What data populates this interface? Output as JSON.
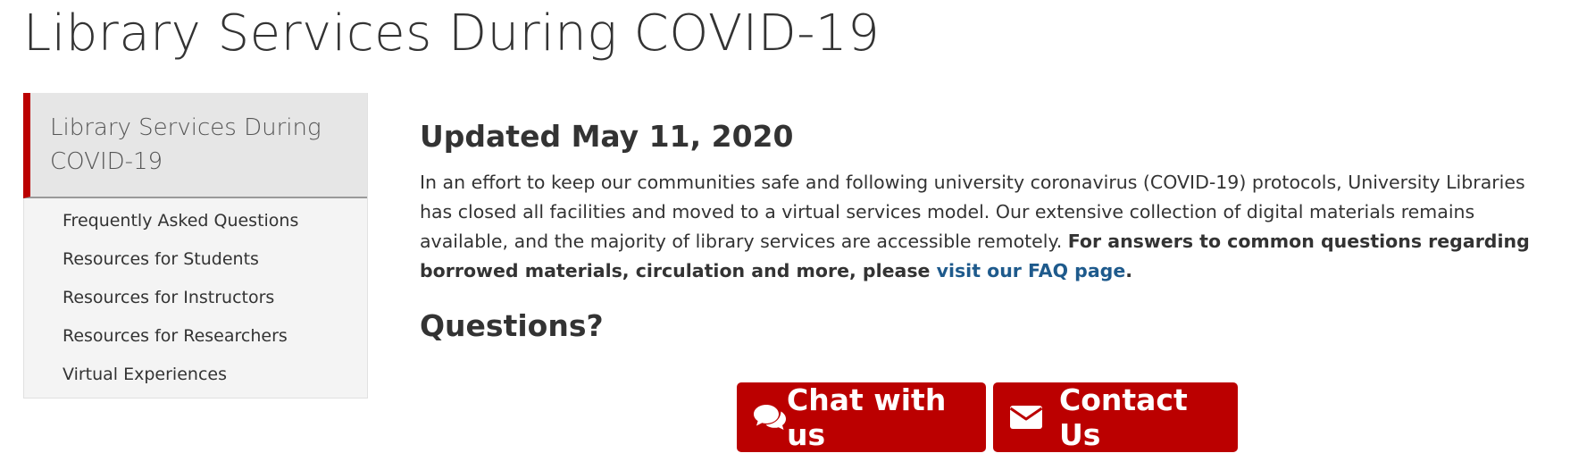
{
  "page": {
    "title": "Library Services During COVID-19"
  },
  "sidebar": {
    "header_label": "Library Services During COVID-19",
    "items": [
      {
        "label": "Frequently Asked Questions"
      },
      {
        "label": "Resources for Students"
      },
      {
        "label": "Resources for Instructors"
      },
      {
        "label": "Resources for Researchers"
      },
      {
        "label": "Virtual Experiences"
      }
    ]
  },
  "main": {
    "updated_heading": "Updated May 11, 2020",
    "intro_text": "In an effort to keep our communities safe and following university coronavirus (COVID-19) protocols, University Libraries has closed all facilities and moved to a virtual services model. Our extensive collection of digital materials remains available, and the majority of library services are accessible remotely. ",
    "intro_bold": "For answers to common questions regarding borrowed materials, circulation and more, please ",
    "faq_link": "visit our FAQ page",
    "intro_end": ".",
    "questions_heading": "Questions?"
  },
  "buttons": {
    "chat_label": "Chat with us",
    "chat_icon": "chat-bubbles-icon",
    "contact_label": "Contact Us",
    "contact_icon": "envelope-icon"
  },
  "colors": {
    "accent": "#bb0000",
    "link": "#1e5a8c",
    "text": "#333333",
    "sidebar_bg": "#f4f4f4"
  }
}
